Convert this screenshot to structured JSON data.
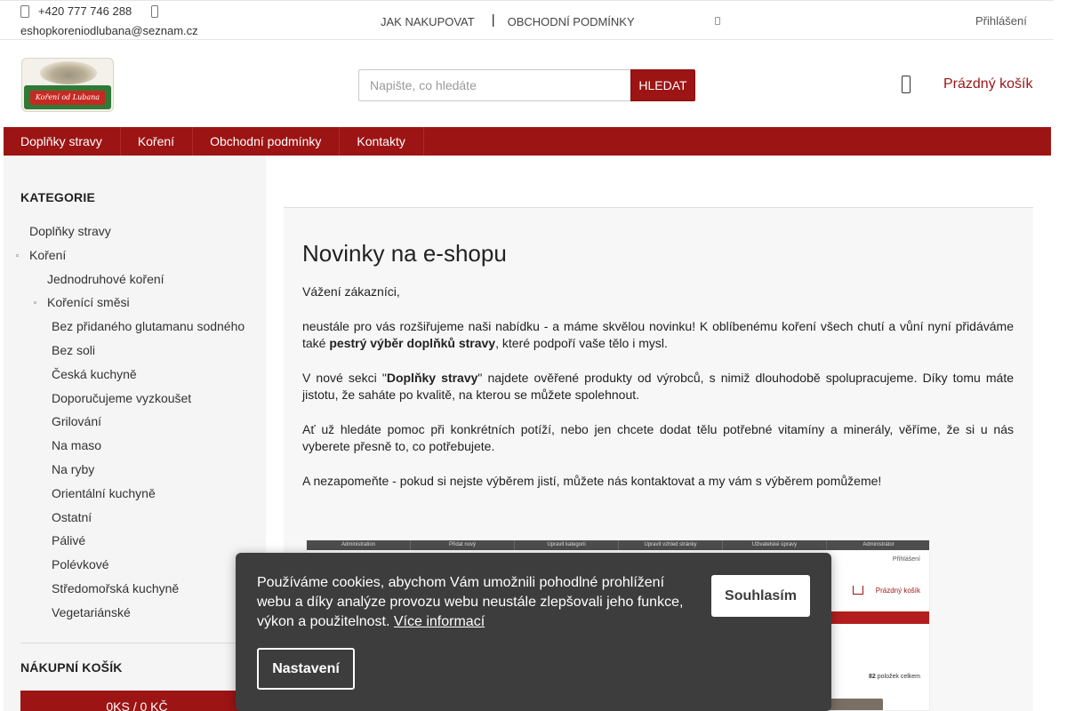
{
  "topbar": {
    "phone": "+420 777 746 288",
    "email": "eshopkoreniodlubana@seznam.cz",
    "links": [
      "JAK NAKUPOVAT",
      "OBCHODNÍ PODMÍNKY"
    ],
    "separator": "|",
    "login": "Přihlášení"
  },
  "logo": {
    "text": "Koření od Lubana"
  },
  "search": {
    "placeholder": "Napište, co hledáte",
    "button": "HLEDAT"
  },
  "cart": {
    "label": "Prázdný košík",
    "icon": "cart-icon"
  },
  "nav": {
    "items": [
      "Doplňky stravy",
      "Koření",
      "Obchodní podmínky",
      "Kontakty"
    ]
  },
  "sidebar": {
    "categories_title": "KATEGORIE",
    "categories": [
      {
        "label": "Doplňky stravy",
        "level": 0,
        "bullet": false
      },
      {
        "label": "Koření",
        "level": 0,
        "bullet": true
      },
      {
        "label": "Jednodruhové koření",
        "level": 1,
        "bullet": false
      },
      {
        "label": "Kořenící směsi",
        "level": 1,
        "bullet": true
      },
      {
        "label": "Bez přidaného glutamanu sodného",
        "level": 2,
        "bullet": false
      },
      {
        "label": "Bez soli",
        "level": 2,
        "bullet": false
      },
      {
        "label": "Česká kuchyně",
        "level": 2,
        "bullet": false
      },
      {
        "label": "Doporučujeme vyzkoušet",
        "level": 2,
        "bullet": false
      },
      {
        "label": "Grilování",
        "level": 2,
        "bullet": false
      },
      {
        "label": "Na maso",
        "level": 2,
        "bullet": false
      },
      {
        "label": "Na ryby",
        "level": 2,
        "bullet": false
      },
      {
        "label": "Orientální kuchyně",
        "level": 2,
        "bullet": false
      },
      {
        "label": "Ostatní",
        "level": 2,
        "bullet": false
      },
      {
        "label": "Pálivé",
        "level": 2,
        "bullet": false
      },
      {
        "label": "Polévkové",
        "level": 2,
        "bullet": false
      },
      {
        "label": "Středomořská kuchyně",
        "level": 2,
        "bullet": false
      },
      {
        "label": "Vegetariánské",
        "level": 2,
        "bullet": false
      }
    ],
    "cart_title": "NÁKUPNÍ KOŠÍK",
    "cart_summary": "0KS / 0 KČ"
  },
  "article": {
    "title": "Novinky na e-shopu",
    "greeting": "Vážení zákazníci,",
    "p1_before": "neustále pro vás rozšiřujeme naši nabídku - a máme skvělou novinku! K oblíbenému koření všech chutí a vůní nyní přidáváme také ",
    "p1_bold": "pestrý výběr doplňků stravy",
    "p1_after": ", které podpoří vaše tělo i mysl.",
    "p2_before": "V nové sekci \"",
    "p2_bold": "Doplňky stravy",
    "p2_after": "\" najdete ověřené produkty od výrobců, s nimiž dlouhodobě spolupracujeme. Díky tomu máte jistotu, že saháte po kvalitě, na kterou se můžete spolehnout.",
    "p3": "Ať už hledáte pomoc při konkrétních potíží, nebo jen chcete dodat tělu potřebné vitamíny a minerály, věříme, že si u nás vyberete přesně to, co potřebujete.",
    "p4": "A nezapomeňte - pokud si nejste výběrem jistí, můžete nás kontaktovat a my vám s výběrem pomůžeme!"
  },
  "preview": {
    "tabs": [
      "Administration",
      "Přidat nový",
      "Upravit kategorii",
      "Upravit vzhled stránky",
      "Uživatelské úpravy",
      "Administrátor"
    ],
    "login": "Přihlášení",
    "cart": "Prázdný košík",
    "count_bold": "82",
    "count": " položek celkem"
  },
  "cookie": {
    "text": "Používáme cookies, abychom Vám umožnili pohodlné prohlížení webu a díky analýze provozu webu neustále zlepšovali jeho funkce, výkon a použitelnost.",
    "link": "Více informací",
    "accept": "Souhlasím",
    "settings": "Nastavení"
  },
  "colors": {
    "brand": "#9d1414",
    "cookie_bg": "#3d3d3d",
    "sidebar_bg": "#f5f5f5"
  }
}
